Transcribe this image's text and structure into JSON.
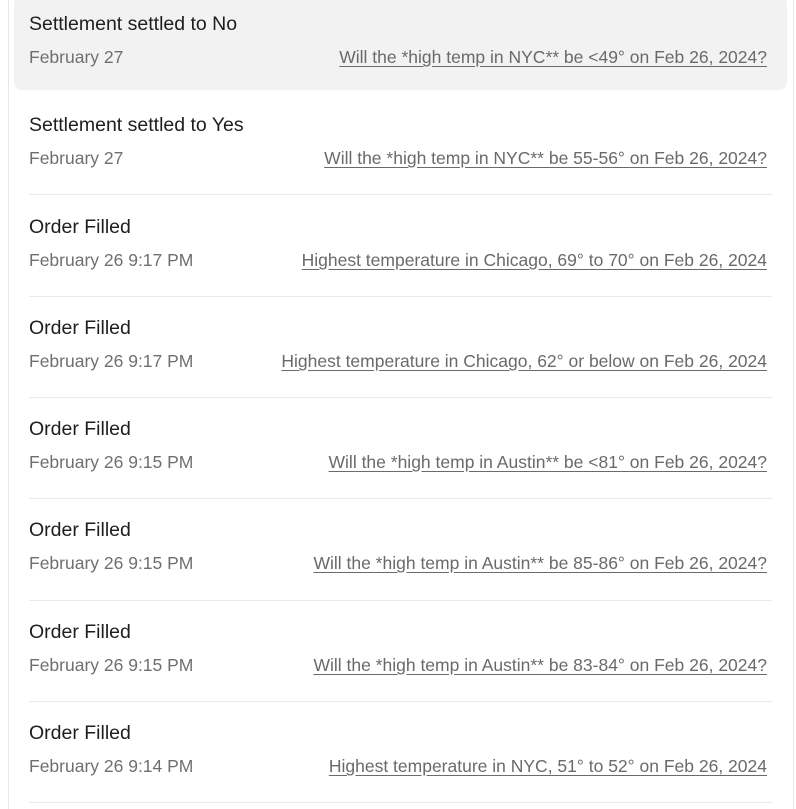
{
  "activity": {
    "items": [
      {
        "title": "Settlement settled to No",
        "date": "February 27",
        "market": "Will the *high temp in NYC** be <49° on Feb 26, 2024?"
      },
      {
        "title": "Settlement settled to Yes",
        "date": "February 27",
        "market": "Will the *high temp in NYC** be 55-56° on Feb 26, 2024?"
      },
      {
        "title": "Order Filled",
        "date": "February 26 9:17 PM",
        "market": "Highest temperature in Chicago, 69° to 70° on Feb 26, 2024"
      },
      {
        "title": "Order Filled",
        "date": "February 26 9:17 PM",
        "market": "Highest temperature in Chicago, 62° or below on Feb 26, 2024"
      },
      {
        "title": "Order Filled",
        "date": "February 26 9:15 PM",
        "market": "Will the *high temp in Austin** be <81° on Feb 26, 2024?"
      },
      {
        "title": "Order Filled",
        "date": "February 26 9:15 PM",
        "market": "Will the *high temp in Austin** be 85-86° on Feb 26, 2024?"
      },
      {
        "title": "Order Filled",
        "date": "February 26 9:15 PM",
        "market": "Will the *high temp in Austin** be 83-84° on Feb 26, 2024?"
      },
      {
        "title": "Order Filled",
        "date": "February 26 9:14 PM",
        "market": "Highest temperature in NYC, 51° to 52° on Feb 26, 2024"
      }
    ]
  }
}
